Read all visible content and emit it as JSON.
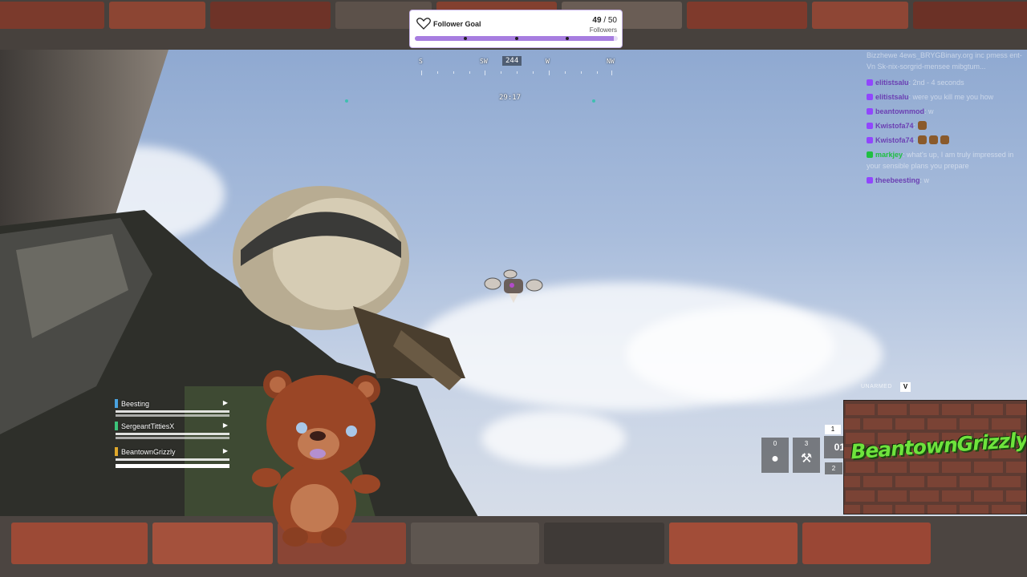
{
  "follower_goal": {
    "title": "Follower Goal",
    "current": "49",
    "separator": "/ 50",
    "subtitle": "Followers",
    "progress_fraction": 0.98,
    "accent_color": "#a77de0"
  },
  "compass": {
    "labels": [
      "S",
      "SW",
      "W",
      "NW"
    ],
    "heading": "244"
  },
  "match": {
    "timer": "29:17"
  },
  "chat": {
    "messages": [
      {
        "user": "",
        "text": "Bizzhewe 4ews_BRYGBinary.org inc pmess ent-Vn Sk-nix-sorgrid-mensee mibgtum..."
      },
      {
        "user": "elitistsalu",
        "text": "2nd - 4 seconds"
      },
      {
        "user": "elitistsalu",
        "text": "were you kill me you how"
      },
      {
        "user": "beantownmod",
        "text": "w"
      },
      {
        "user": "Kwistofa74",
        "text": ""
      },
      {
        "user": "Kwistofa74",
        "text": ""
      },
      {
        "user": "markjey",
        "text": "what's up, I am truly impressed in your sensible plans you prepare"
      },
      {
        "user": "theebeesting",
        "text": "w"
      }
    ]
  },
  "squad": {
    "members": [
      {
        "name": "Beesting",
        "color": "#4aa3e0"
      },
      {
        "name": "SergeantTittiesX",
        "color": "#3cc47a"
      },
      {
        "name": "BeantownGrizzly",
        "color": "#e0a82a"
      }
    ]
  },
  "loadout": {
    "weapon_label": "UNARMED",
    "weapon_key": "V",
    "slots": [
      {
        "count": "0",
        "icon": "grenade-icon"
      },
      {
        "count": "3",
        "icon": "pickaxe-icon"
      }
    ],
    "selector": [
      "1",
      "01",
      "2"
    ]
  },
  "logo": {
    "text": "BeantownGrizzly"
  }
}
